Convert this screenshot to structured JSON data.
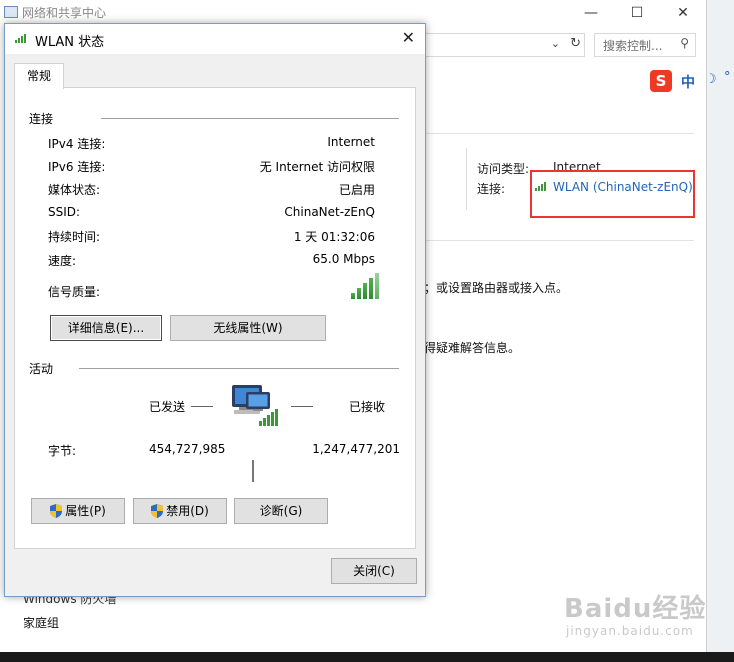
{
  "background_window": {
    "title": "网络和共享中心",
    "controls": {
      "minimize": "—",
      "maximize": "☐",
      "close": "✕"
    },
    "search_placeholder": "搜索控制...",
    "connection_info": {
      "access_type_label": "访问类型:",
      "access_type_value": "Internet",
      "connection_label": "连接:",
      "connection_link": "WLAN (ChinaNet-zEnQ)"
    },
    "partial_text_1": "；或设置路由器或接入点。",
    "partial_text_2": "得疑难解答信息。",
    "bottom_items": [
      "Windows 防火墙",
      "家庭组"
    ]
  },
  "ime_bar": {
    "logo": "S",
    "mode": "中",
    "moon": "☽",
    "dot": "°"
  },
  "watermark": {
    "text": "Baidu经验",
    "url": "jingyan.baidu.com"
  },
  "dialog": {
    "title": "WLAN 状态",
    "tab": "常规",
    "connection_section": "连接",
    "rows": [
      {
        "label": "IPv4 连接:",
        "value": "Internet"
      },
      {
        "label": "IPv6 连接:",
        "value": "无 Internet 访问权限"
      },
      {
        "label": "媒体状态:",
        "value": "已启用"
      },
      {
        "label": "SSID:",
        "value": "ChinaNet-zEnQ"
      },
      {
        "label": "持续时间:",
        "value": "1 天 01:32:06"
      },
      {
        "label": "速度:",
        "value": "65.0 Mbps"
      }
    ],
    "signal_label": "信号质量:",
    "details_button": "详细信息(E)...",
    "wireless_props_button": "无线属性(W)",
    "activity_section": "活动",
    "sent_label": "已发送",
    "received_label": "已接收",
    "bytes_label": "字节:",
    "bytes_sent": "454,727,985",
    "bytes_received": "1,247,477,201",
    "properties_button": "属性(P)",
    "disable_button": "禁用(D)",
    "diagnose_button": "诊断(G)",
    "close_button": "关闭(C)"
  }
}
